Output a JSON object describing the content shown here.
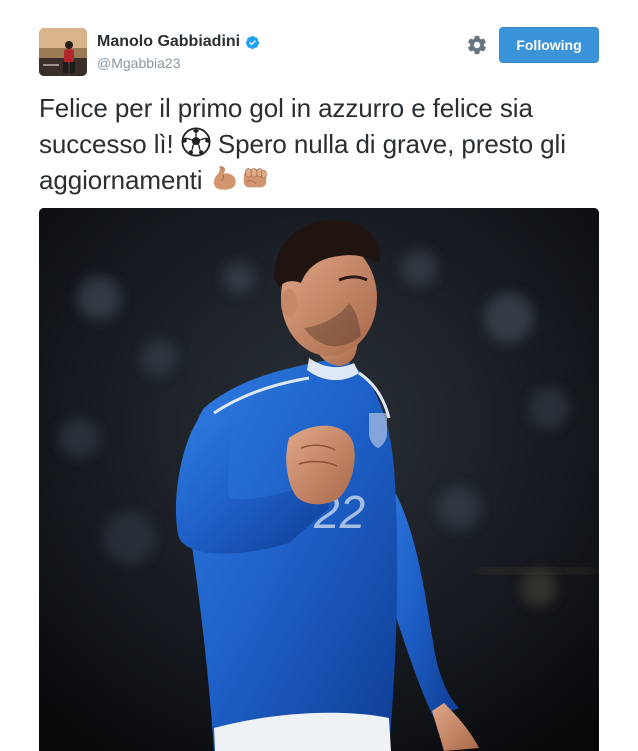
{
  "user": {
    "display_name": "Manolo Gabbiadini",
    "handle": "@Mgabbia23",
    "verified": true
  },
  "actions": {
    "follow_label": "Following",
    "settings_icon": "gear-icon"
  },
  "tweet": {
    "text_part1": "Felice per il primo gol in azzurro e felice sia successo lì! ",
    "emoji_soccer": "soccer-ball-emoji",
    "text_part2": " Spero nulla di grave, presto gli aggiornamenti ",
    "emoji_muscle": "flexed-biceps-emoji",
    "emoji_fist": "oncoming-fist-emoji"
  },
  "media": {
    "photo": "player-celebration-photo"
  },
  "colors": {
    "follow_button": "#3b94d9",
    "text": "#292f33",
    "muted": "#8899a6",
    "verified": "#1da1f2",
    "jersey": "#1f63c9"
  }
}
